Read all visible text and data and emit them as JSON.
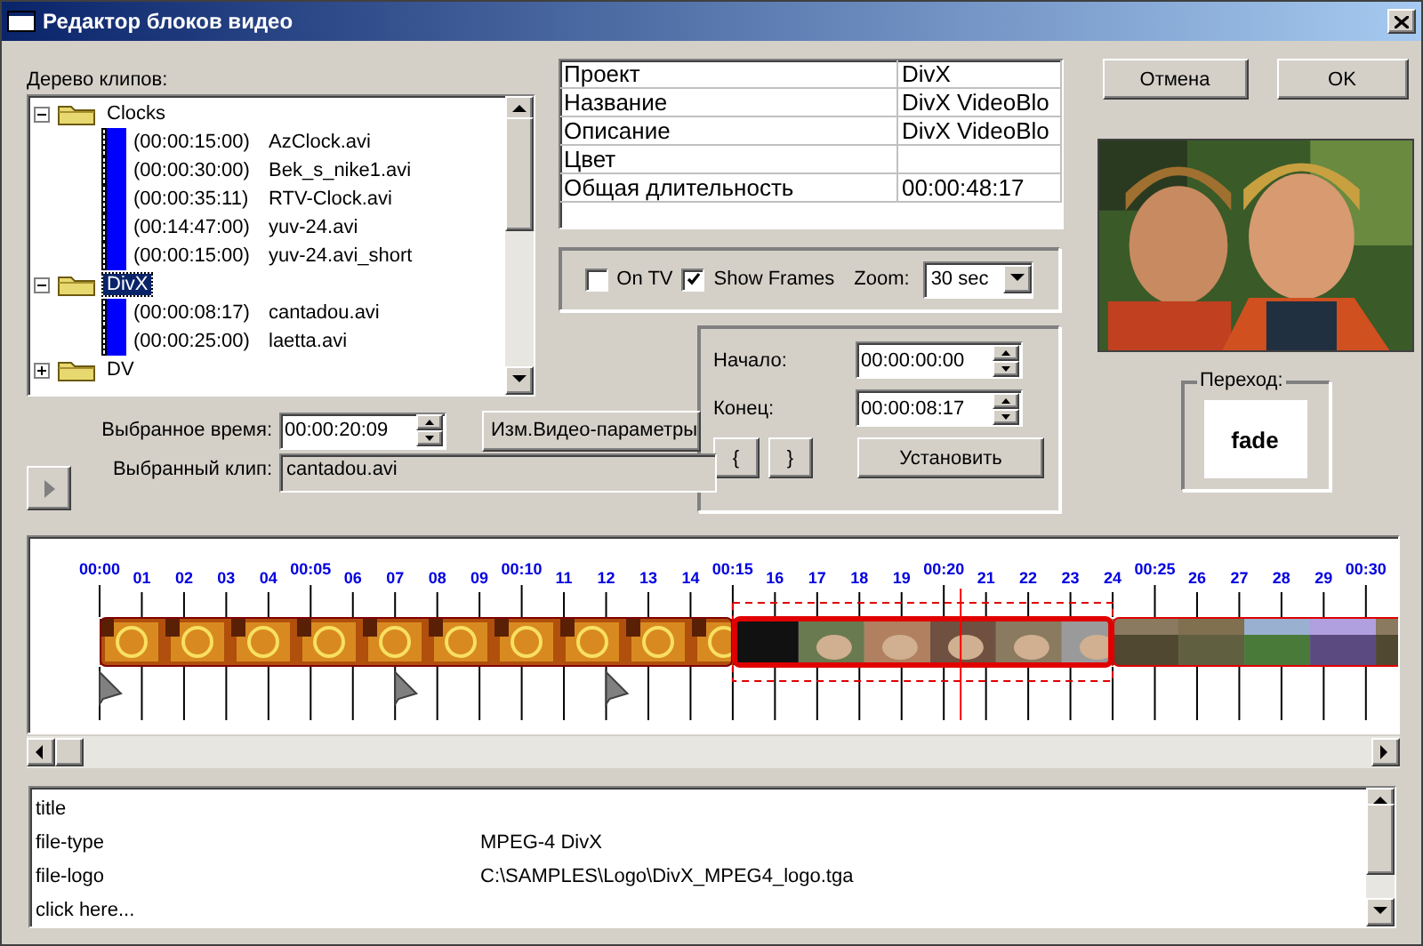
{
  "window": {
    "title": "Редактор блоков видео"
  },
  "buttons": {
    "cancel": "Отмена",
    "ok": "OK"
  },
  "tree": {
    "label": "Дерево клипов:",
    "items": [
      {
        "kind": "folder",
        "label": "Clocks",
        "expanded": true,
        "selected": false,
        "children": [
          {
            "kind": "clip",
            "duration": "(00:00:15:00)",
            "label": "AzClock.avi",
            "selected": false
          },
          {
            "kind": "clip",
            "duration": "(00:00:30:00)",
            "label": "Bek_s_nike1.avi",
            "selected": false
          },
          {
            "kind": "clip",
            "duration": "(00:00:35:11)",
            "label": "RTV-Clock.avi",
            "selected": false
          },
          {
            "kind": "clip",
            "duration": "(00:14:47:00)",
            "label": "yuv-24.avi",
            "selected": false
          },
          {
            "kind": "clip",
            "duration": "(00:00:15:00)",
            "label": "yuv-24.avi_short",
            "selected": false
          }
        ]
      },
      {
        "kind": "folder",
        "label": "DivX",
        "expanded": true,
        "selected": true,
        "children": [
          {
            "kind": "clip",
            "duration": "(00:00:08:17)",
            "label": "cantadou.avi",
            "selected": false
          },
          {
            "kind": "clip",
            "duration": "(00:00:25:00)",
            "label": "laetta.avi",
            "selected": false
          }
        ]
      },
      {
        "kind": "folder",
        "label": "DV",
        "expanded": false,
        "selected": false
      }
    ]
  },
  "selection": {
    "time_label": "Выбранное время:",
    "time": "00:00:20:09",
    "clip_label": "Выбранный клип:",
    "clip": "cantadou.avi",
    "params_button": "Изм.Видео-параметры"
  },
  "properties": [
    {
      "name": "Проект",
      "value": "DivX"
    },
    {
      "name": "Название",
      "value": "DivX VideoBlo"
    },
    {
      "name": "Описание",
      "value": "DivX VideoBlo"
    },
    {
      "name": "Цвет"
    },
    {
      "name": "Общая длительность",
      "value": "00:00:48:17"
    }
  ],
  "options": {
    "on_tv": {
      "label": "On TV",
      "checked": false
    },
    "show_frames": {
      "label": "Show Frames",
      "checked": true
    },
    "zoom_label": "Zoom:",
    "zoom": "30 sec"
  },
  "range": {
    "start_label": "Начало:",
    "start": "00:00:00:00",
    "end_label": "Конец:",
    "end": "00:00:08:17",
    "mark_in": "{",
    "mark_out": "}",
    "set_button": "Установить"
  },
  "transition": {
    "label": "Переход:",
    "value": "fade"
  },
  "timeline": {
    "ticks": [
      "00:00",
      "01",
      "02",
      "03",
      "04",
      "00:05",
      "06",
      "07",
      "08",
      "09",
      "00:10",
      "11",
      "12",
      "13",
      "14",
      "00:15",
      "16",
      "17",
      "18",
      "19",
      "00:20",
      "21",
      "22",
      "23",
      "24",
      "00:25",
      "26",
      "27",
      "28",
      "29",
      "00:30"
    ],
    "clips": [
      {
        "kind": "fire",
        "selected": false
      },
      {
        "kind": "film",
        "selected": true
      },
      {
        "kind": "outdoor",
        "selected": false
      }
    ]
  },
  "attributes": [
    {
      "name": "title"
    },
    {
      "name": "file-type",
      "value": "MPEG-4 DivX"
    },
    {
      "name": "file-logo",
      "value": "C:\\SAMPLES\\Logo\\DivX_MPEG4_logo.tga"
    },
    {
      "name": "click here..."
    }
  ]
}
